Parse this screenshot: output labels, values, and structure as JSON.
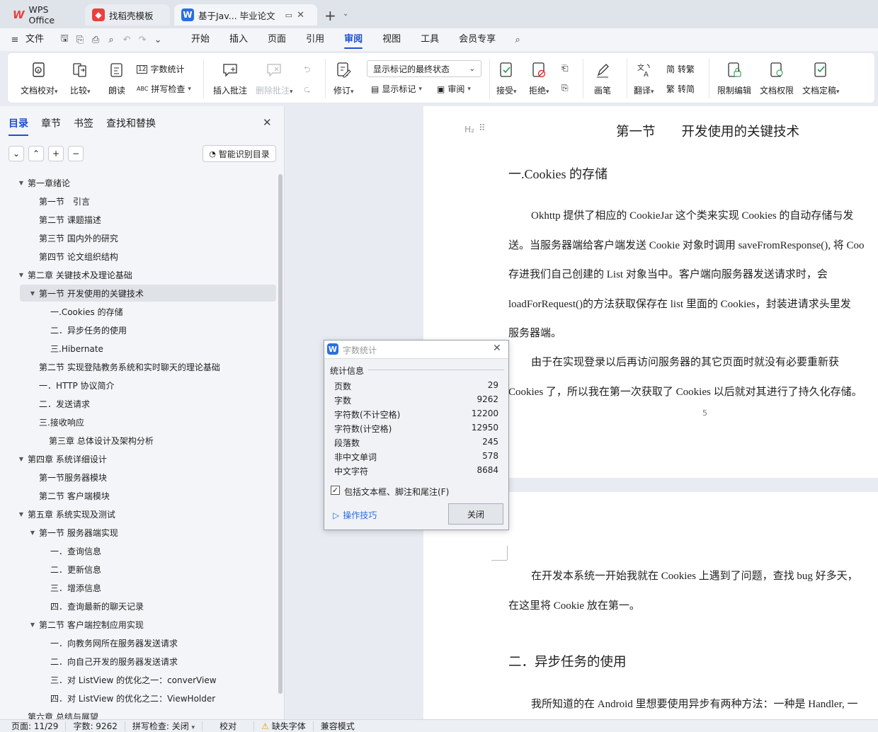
{
  "titlebar": {
    "tabs": [
      {
        "label": "WPS Office",
        "icon": "wps-logo-icon"
      },
      {
        "label": "找稻壳模板",
        "icon": "docer-icon"
      },
      {
        "label": "基于Jav... 毕业论文",
        "icon": "writer-doc-icon"
      }
    ],
    "new_tab": "+"
  },
  "menubar": {
    "file": "文件",
    "items": [
      "开始",
      "插入",
      "页面",
      "引用",
      "审阅",
      "视图",
      "工具",
      "会员专享"
    ],
    "active": "审阅"
  },
  "ribbon": {
    "doc_check": "文档校对",
    "compare": "比较",
    "read_aloud": "朗读",
    "word_count": "字数统计",
    "spell_check": "拼写检查",
    "insert_comment": "插入批注",
    "delete_comment": "删除批注",
    "revise": "修订",
    "markup_select": "显示标记的最终状态",
    "show_markup": "显示标记",
    "review": "审阅",
    "accept": "接受",
    "reject": "拒绝",
    "pen": "画笔",
    "translate": "翻译",
    "to_traditional": "转繁",
    "to_simplified": "转简",
    "restrict_edit": "限制编辑",
    "doc_permission": "文档权限",
    "finalize": "文档定稿"
  },
  "sidebar": {
    "tabs": [
      "目录",
      "章节",
      "书签",
      "查找和替换"
    ],
    "smart_toc": "智能识别目录",
    "toc": [
      {
        "label": "第一章绪论",
        "level": 1,
        "toggle": "down"
      },
      {
        "label": "第一节　引言",
        "level": 2
      },
      {
        "label": "第二节  课题描述",
        "level": 2
      },
      {
        "label": "第三节  国内外的研究",
        "level": 2
      },
      {
        "label": "第四节  论文组织结构",
        "level": 2
      },
      {
        "label": "第二章  关键技术及理论基础",
        "level": 1,
        "toggle": "down"
      },
      {
        "label": "第一节  开发使用的关键技术",
        "level": 2,
        "toggle": "down",
        "selected": true
      },
      {
        "label": "一.Cookies 的存储",
        "level": 3
      },
      {
        "label": "二．异步任务的使用",
        "level": 3
      },
      {
        "label": "三.Hibernate",
        "level": 3
      },
      {
        "label": "第二节  实现登陆教务系统和实时聊天的理论基础",
        "level": 2
      },
      {
        "label": "一．HTTP 协议简介",
        "level": 2
      },
      {
        "label": "二．发送请求",
        "level": 2
      },
      {
        "label": "三.接收响应",
        "level": 2
      },
      {
        "label": "第三章  总体设计及架构分析",
        "level": 2.5
      },
      {
        "label": "第四章  系统详细设计",
        "level": 1,
        "toggle": "down"
      },
      {
        "label": "第一节服务器模块",
        "level": 2
      },
      {
        "label": "第二节  客户端模块",
        "level": 2
      },
      {
        "label": "第五章  系统实现及测试",
        "level": 1,
        "toggle": "down"
      },
      {
        "label": "第一节  服务器端实现",
        "level": 2,
        "toggle": "down"
      },
      {
        "label": "一．查询信息",
        "level": 3
      },
      {
        "label": "二．更新信息",
        "level": 3
      },
      {
        "label": "三．增添信息",
        "level": 3
      },
      {
        "label": "四．查询最新的聊天记录",
        "level": 3
      },
      {
        "label": "第二节  客户端控制应用实现",
        "level": 2,
        "toggle": "down"
      },
      {
        "label": "一．向教务网所在服务器发送请求",
        "level": 3
      },
      {
        "label": "二．向自己开发的服务器发送请求",
        "level": 3
      },
      {
        "label": "三．对 ListView 的优化之一：converView",
        "level": 3
      },
      {
        "label": "四．对 ListView 的优化之二：ViewHolder",
        "level": 3
      },
      {
        "label": "第六章  总结与展望",
        "level": 1
      }
    ]
  },
  "document": {
    "heading_marker": "H₂",
    "section_title": "第一节　　开发使用的关键技术",
    "sub1": "一.Cookies 的存储",
    "p1": [
      "Okhttp 提供了相应的 CookieJar 这个类来实现 Cookies 的自动存储与发",
      "送。当服务器端给客户端发送 Cookie 对象时调用 saveFromResponse(), 将 Coo",
      "存进我们自己创建的 List 对象当中。客户端向服务器发送请求时，会",
      "loadForRequest()的方法获取保存在 list 里面的 Cookies，封装进请求头里发",
      "服务器端。"
    ],
    "p2": [
      "由于在实现登录以后再访问服务器的其它页面时就没有必要重新获",
      "Cookies 了，所以我在第一次获取了 Cookies 以后就对其进行了持久化存储。"
    ],
    "page_number": "5",
    "p3": [
      "在开发本系统一开始我就在 Cookies 上遇到了问题，查找 bug 好多天，",
      "在这里将 Cookie 放在第一。"
    ],
    "sub2": "二．异步任务的使用",
    "p4": "我所知道的在 Android 里想要使用异步有两种方法：一种是 Handler, 一"
  },
  "dialog": {
    "title": "字数统计",
    "group": "统计信息",
    "stats": [
      {
        "label": "页数",
        "value": "29"
      },
      {
        "label": "字数",
        "value": "9262"
      },
      {
        "label": "字符数(不计空格)",
        "value": "12200"
      },
      {
        "label": "字符数(计空格)",
        "value": "12950"
      },
      {
        "label": "段落数",
        "value": "245"
      },
      {
        "label": "非中文单词",
        "value": "578"
      },
      {
        "label": "中文字符",
        "value": "8684"
      }
    ],
    "include_label": "包括文本框、脚注和尾注(F)",
    "include_checked": true,
    "tips": "操作技巧",
    "close": "关闭"
  },
  "status": {
    "page": "页面: 11/29",
    "words": "字数: 9262",
    "spell": "拼写检查: 关闭",
    "proof": "校对",
    "missing_font": "缺失字体",
    "compat": "兼容模式"
  },
  "colors": {
    "accent": "#1d4fcf",
    "wps_red": "#e8403a",
    "writer_blue": "#2b6de3"
  }
}
